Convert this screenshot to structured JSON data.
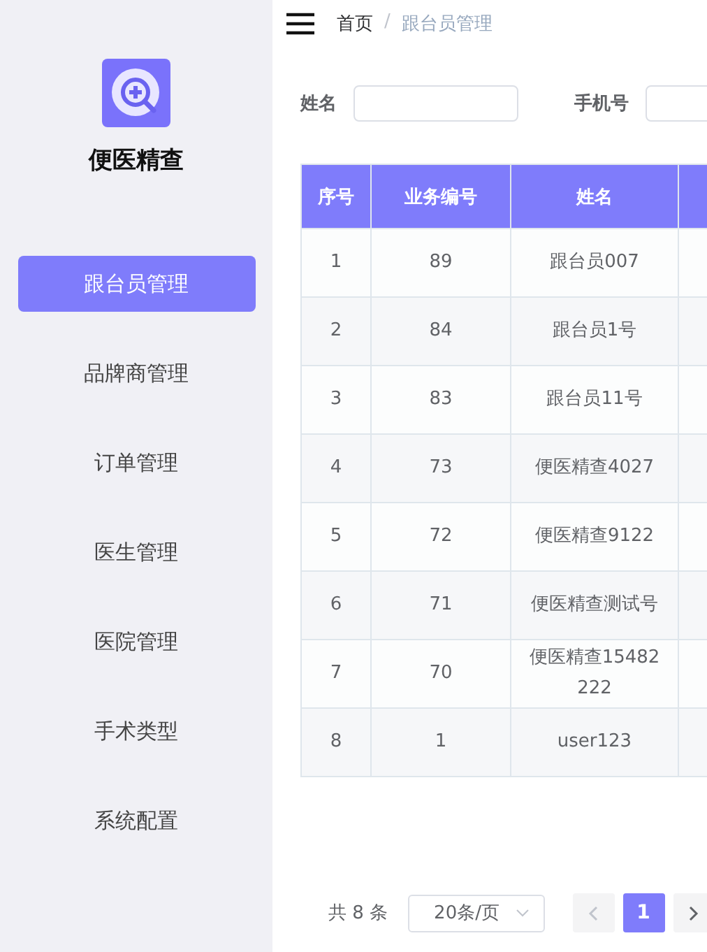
{
  "sidebar": {
    "brand": "便医精查",
    "items": [
      {
        "label": "跟台员管理",
        "selected": true
      },
      {
        "label": "品牌商管理",
        "selected": false
      },
      {
        "label": "订单管理",
        "selected": false
      },
      {
        "label": "医生管理",
        "selected": false
      },
      {
        "label": "医院管理",
        "selected": false
      },
      {
        "label": "手术类型",
        "selected": false
      },
      {
        "label": "系统配置",
        "selected": false
      }
    ]
  },
  "breadcrumb": [
    "首页",
    "跟台员管理"
  ],
  "breadcrumb_separator": "/",
  "filters": [
    {
      "label": "姓名"
    },
    {
      "label": "手机号"
    }
  ],
  "table": {
    "columns": [
      "序号",
      "业务编号",
      "姓名"
    ],
    "rows": [
      {
        "cells": [
          "1",
          "89",
          "跟台员007"
        ]
      },
      {
        "cells": [
          "2",
          "84",
          "跟台员1号"
        ]
      },
      {
        "cells": [
          "3",
          "83",
          "跟台员11号"
        ]
      },
      {
        "cells": [
          "4",
          "73",
          "便医精查4027"
        ]
      },
      {
        "cells": [
          "5",
          "72",
          "便医精查9122"
        ]
      },
      {
        "cells": [
          "6",
          "71",
          "便医精查测试号"
        ]
      },
      {
        "cells": [
          "7",
          "70",
          "便医精查15482222"
        ]
      },
      {
        "cells": [
          "8",
          "1",
          "user123"
        ]
      }
    ]
  },
  "pagination": {
    "total": "共 8 条",
    "page_size": "20条/页",
    "prev_disabled": true,
    "pages": [
      {
        "label": "1",
        "selected": true
      }
    ]
  }
}
